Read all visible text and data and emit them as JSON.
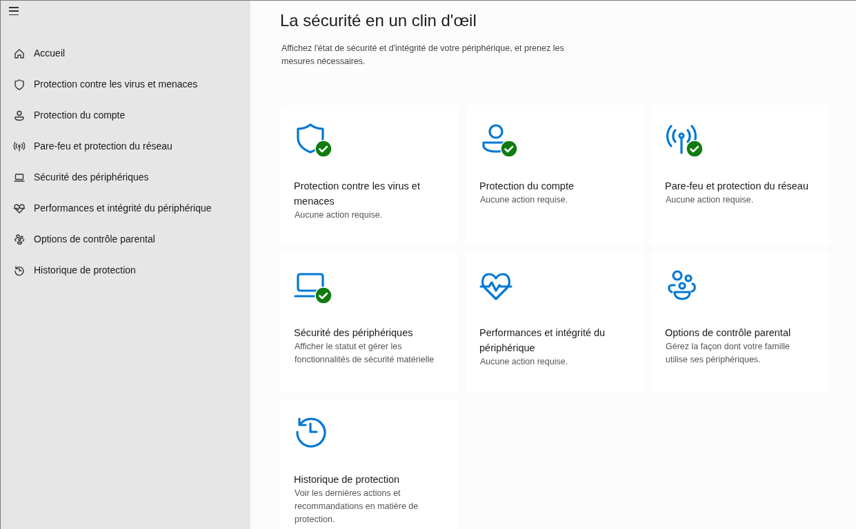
{
  "sidebar": {
    "items": [
      {
        "label": "Accueil"
      },
      {
        "label": "Protection contre les virus et menaces"
      },
      {
        "label": "Protection du compte"
      },
      {
        "label": "Pare-feu et protection du réseau"
      },
      {
        "label": "Sécurité des périphériques"
      },
      {
        "label": "Performances et intégrité du périphérique"
      },
      {
        "label": "Options de contrôle parental"
      },
      {
        "label": "Historique de protection"
      }
    ]
  },
  "page": {
    "title": "La sécurité en un clin d'œil",
    "description": "Affichez l'état de sécurité et d'intégrité de votre périphérique, et prenez les mesures nécessaires."
  },
  "tiles": [
    {
      "title": "Protection contre les virus et menaces",
      "subtitle": "Aucune action requise.",
      "ok": true
    },
    {
      "title": "Protection du compte",
      "subtitle": "Aucune action requise.",
      "ok": true
    },
    {
      "title": "Pare-feu et protection du réseau",
      "subtitle": "Aucune action requise.",
      "ok": true
    },
    {
      "title": "Sécurité des périphériques",
      "subtitle": "Afficher le statut et gérer les fonctionnalités de sécurité matérielle",
      "ok": true
    },
    {
      "title": "Performances et intégrité du périphérique",
      "subtitle": "Aucune action requise.",
      "ok": false
    },
    {
      "title": "Options de contrôle parental",
      "subtitle": "Gérez la façon dont votre famille utilise ses périphériques.",
      "ok": false
    },
    {
      "title": "Historique de protection",
      "subtitle": "Voir les dernières actions et recommandations en matière de protection.",
      "ok": false
    }
  ]
}
